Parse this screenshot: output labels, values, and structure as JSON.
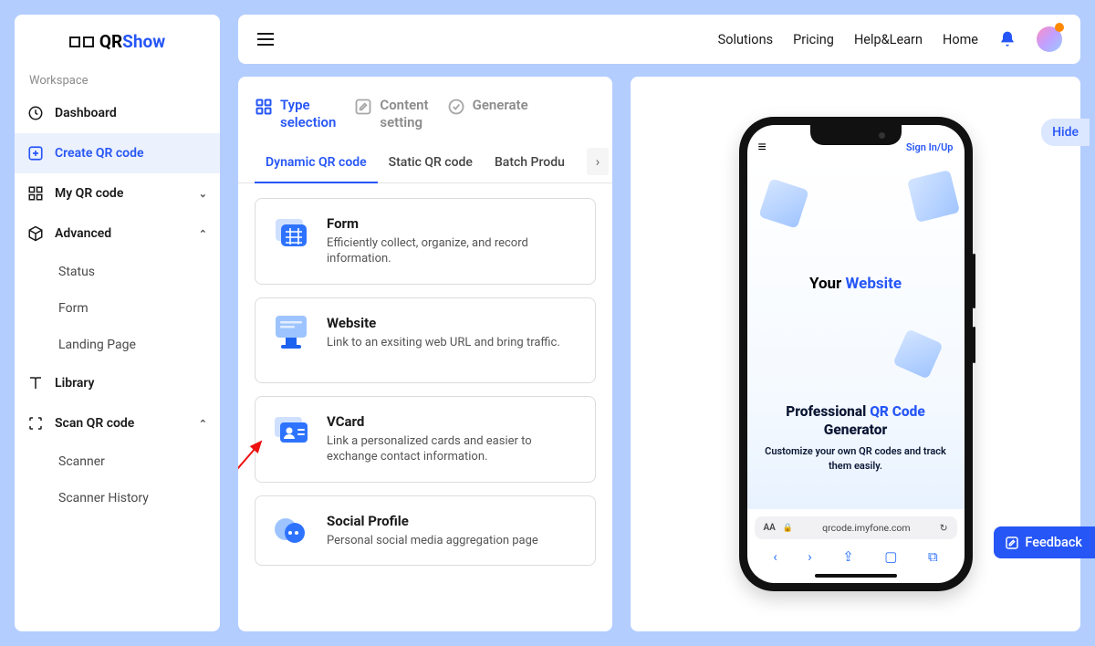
{
  "brand": {
    "pre": "QR",
    "post": "Show"
  },
  "sidebar": {
    "section": "Workspace",
    "items": [
      {
        "label": "Dashboard"
      },
      {
        "label": "Create QR code"
      },
      {
        "label": "My QR code"
      },
      {
        "label": "Advanced",
        "children": [
          {
            "label": "Status"
          },
          {
            "label": "Form"
          },
          {
            "label": "Landing Page"
          }
        ]
      },
      {
        "label": "Library"
      },
      {
        "label": "Scan QR code",
        "children": [
          {
            "label": "Scanner"
          },
          {
            "label": "Scanner History"
          }
        ]
      }
    ]
  },
  "topnav": {
    "links": [
      "Solutions",
      "Pricing",
      "Help&Learn",
      "Home"
    ]
  },
  "steps": [
    {
      "label": "Type\nselection",
      "active": true
    },
    {
      "label": "Content\nsetting",
      "active": false
    },
    {
      "label": "Generate",
      "active": false
    }
  ],
  "tabs": {
    "items": [
      "Dynamic QR code",
      "Static QR code",
      "Batch Produ"
    ],
    "activeIndex": 0
  },
  "cards": [
    {
      "title": "Form",
      "desc": "Efficiently collect, organize, and record information."
    },
    {
      "title": "Website",
      "desc": "Link to an exsiting web URL and bring traffic."
    },
    {
      "title": "VCard",
      "desc": "Link a personalized cards and easier to exchange contact information."
    },
    {
      "title": "Social Profile",
      "desc": "Personal social media aggregation page"
    }
  ],
  "preview": {
    "hide": "Hide",
    "phone": {
      "signin": "Sign In/Up",
      "hero1_pre": "Your ",
      "hero1_accent": "Website",
      "hero2_pre": "Professional ",
      "hero2_accent": "QR Code",
      "hero2_post": " Generator",
      "sub": "Customize your own QR codes and track them easily.",
      "url_aa": "AA",
      "url": "qrcode.imyfone.com"
    }
  },
  "feedback": "Feedback"
}
